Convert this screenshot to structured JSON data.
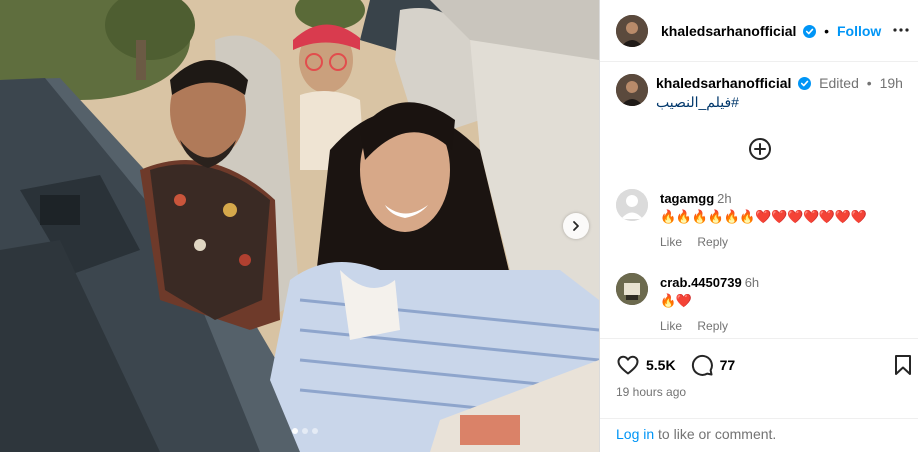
{
  "post": {
    "username": "khaledsarhanofficial",
    "follow_separator": "•",
    "follow_label": "Follow",
    "edited_label": "Edited",
    "meta_separator": "•",
    "time_ago": "19h",
    "hashtag": "#فيلم_النصيب",
    "likes": "5.5K",
    "comments_count": "77",
    "posted_ago": "19 hours ago",
    "carousel_total": 3,
    "carousel_active": 1
  },
  "comments": [
    {
      "username": "tagamgg",
      "time": "2h",
      "text": "🔥🔥🔥🔥🔥🔥❤️❤️❤️❤️❤️❤️❤️",
      "like_label": "Like",
      "reply_label": "Reply"
    },
    {
      "username": "crab.4450739",
      "time": "6h",
      "text": "🔥❤️",
      "like_label": "Like",
      "reply_label": "Reply"
    }
  ],
  "login": {
    "link_label": "Log in",
    "rest": " to like or comment."
  },
  "icons": {
    "verified": "verified-badge-icon",
    "more": "more-options-icon",
    "load_more": "add-circle-icon",
    "like": "heart-icon",
    "comment": "comment-icon",
    "save": "bookmark-icon",
    "next": "chevron-right-icon"
  },
  "colors": {
    "link_blue": "#0095f6",
    "hashtag": "#00376b",
    "muted": "#737373"
  }
}
